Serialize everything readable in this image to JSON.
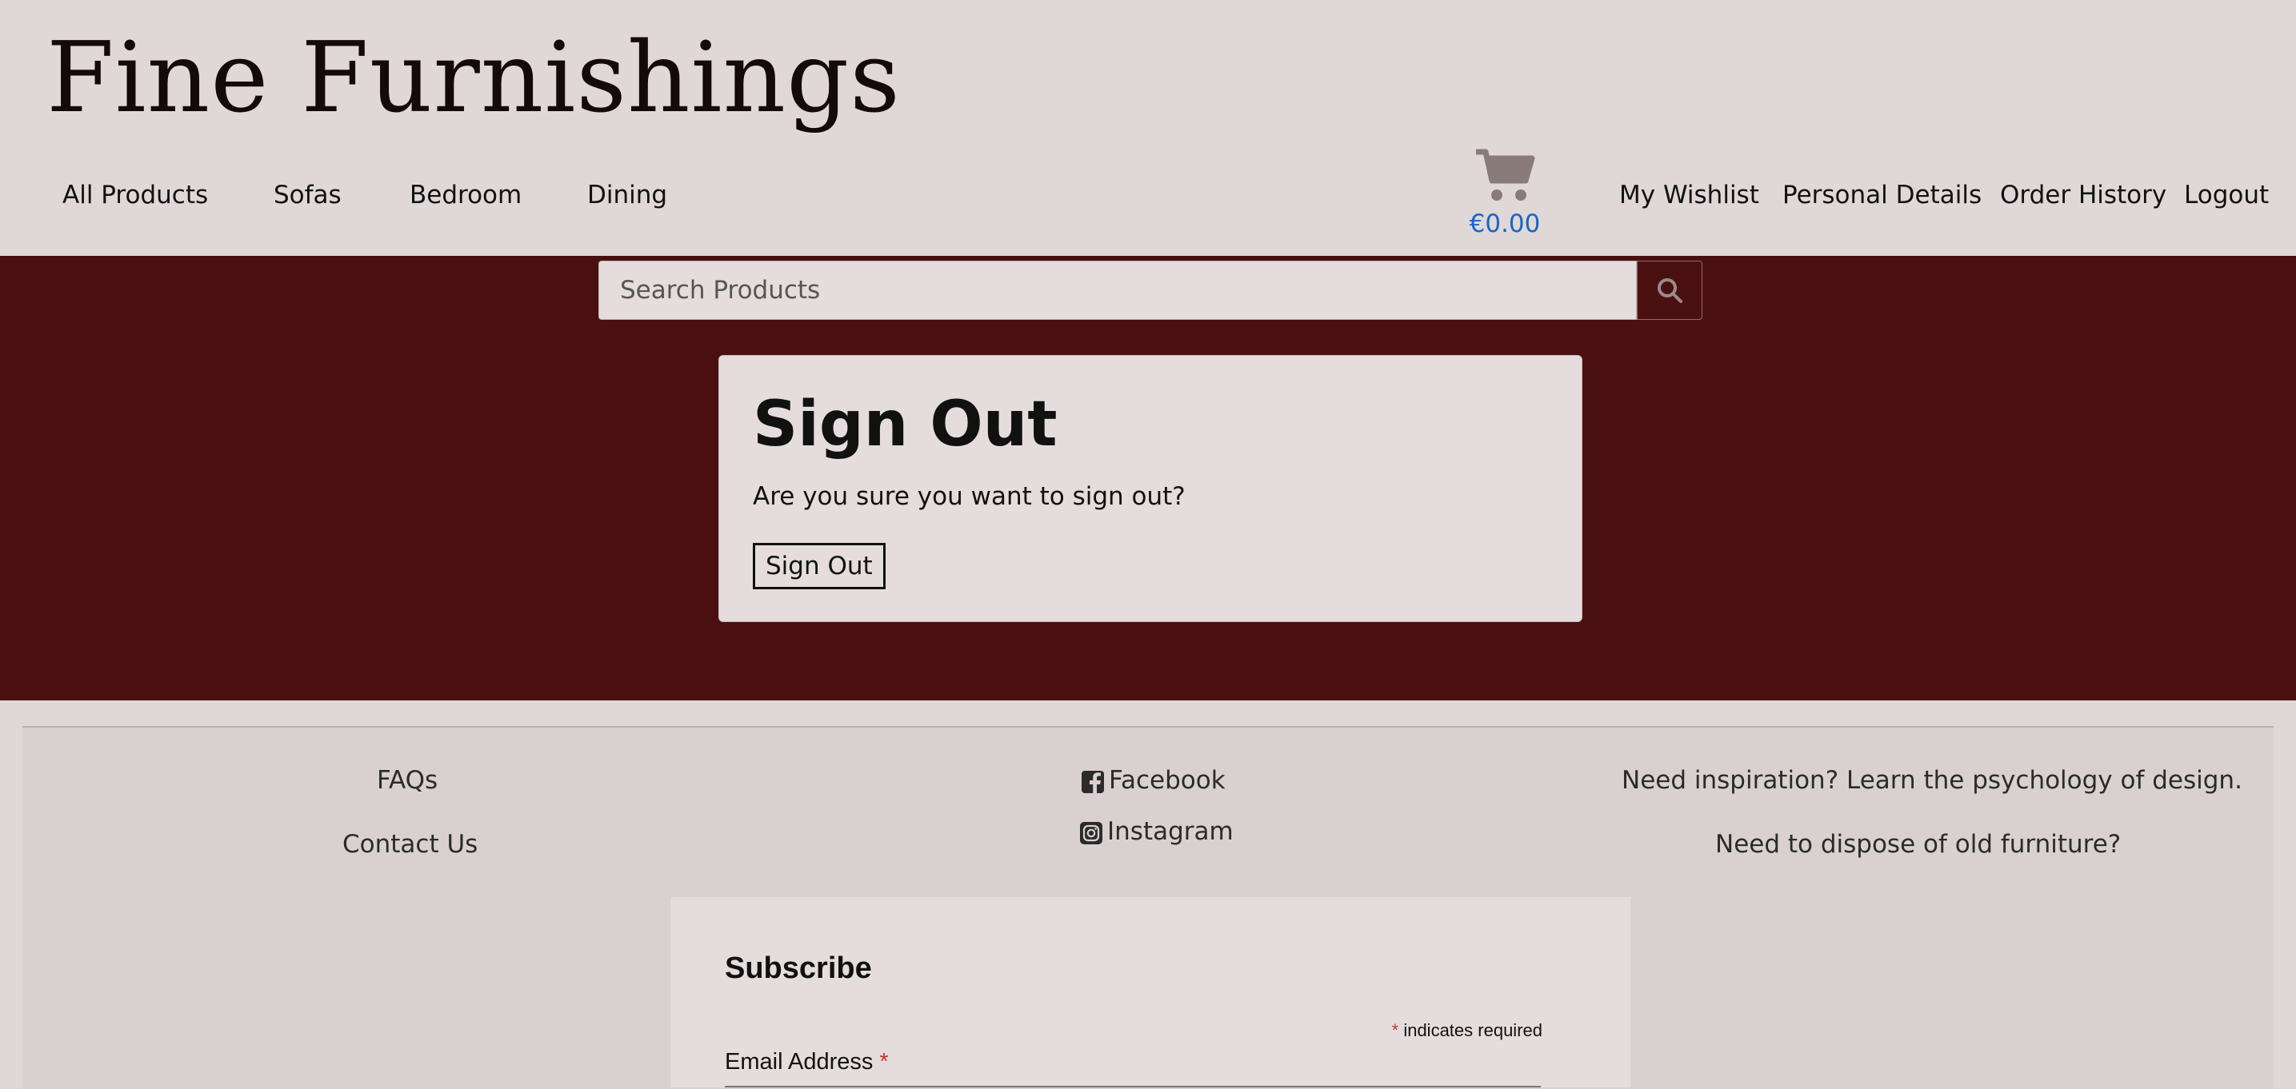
{
  "header": {
    "logo": "Fine Furnishings",
    "nav_left": [
      "All Products",
      "Sofas",
      "Bedroom",
      "Dining"
    ],
    "cart_total": "€0.00",
    "nav_right": [
      "My Wishlist",
      "Personal Details",
      "Order History",
      "Logout"
    ]
  },
  "search": {
    "placeholder": "Search Products"
  },
  "main": {
    "title": "Sign Out",
    "message": "Are you sure you want to sign out?",
    "button_label": "Sign Out"
  },
  "footer": {
    "col1": [
      "FAQs",
      "Contact Us"
    ],
    "col2": [
      "Facebook",
      "Instagram"
    ],
    "col3": [
      "Need inspiration? Learn the psychology of design.",
      "Need to dispose of old furniture?"
    ]
  },
  "subscribe": {
    "title": "Subscribe",
    "required_star": "*",
    "required_note": "indicates required",
    "email_label": "Email Address",
    "email_star": "*"
  },
  "colors": {
    "banner": "#4a1011",
    "page_bg": "#e0d7d7",
    "price": "#1767c5",
    "cart_icon": "#8a7b7b"
  },
  "icons": {
    "cart": "shopping-cart-icon",
    "search": "magnifier-icon",
    "facebook": "facebook-square-icon",
    "instagram": "instagram-icon"
  }
}
